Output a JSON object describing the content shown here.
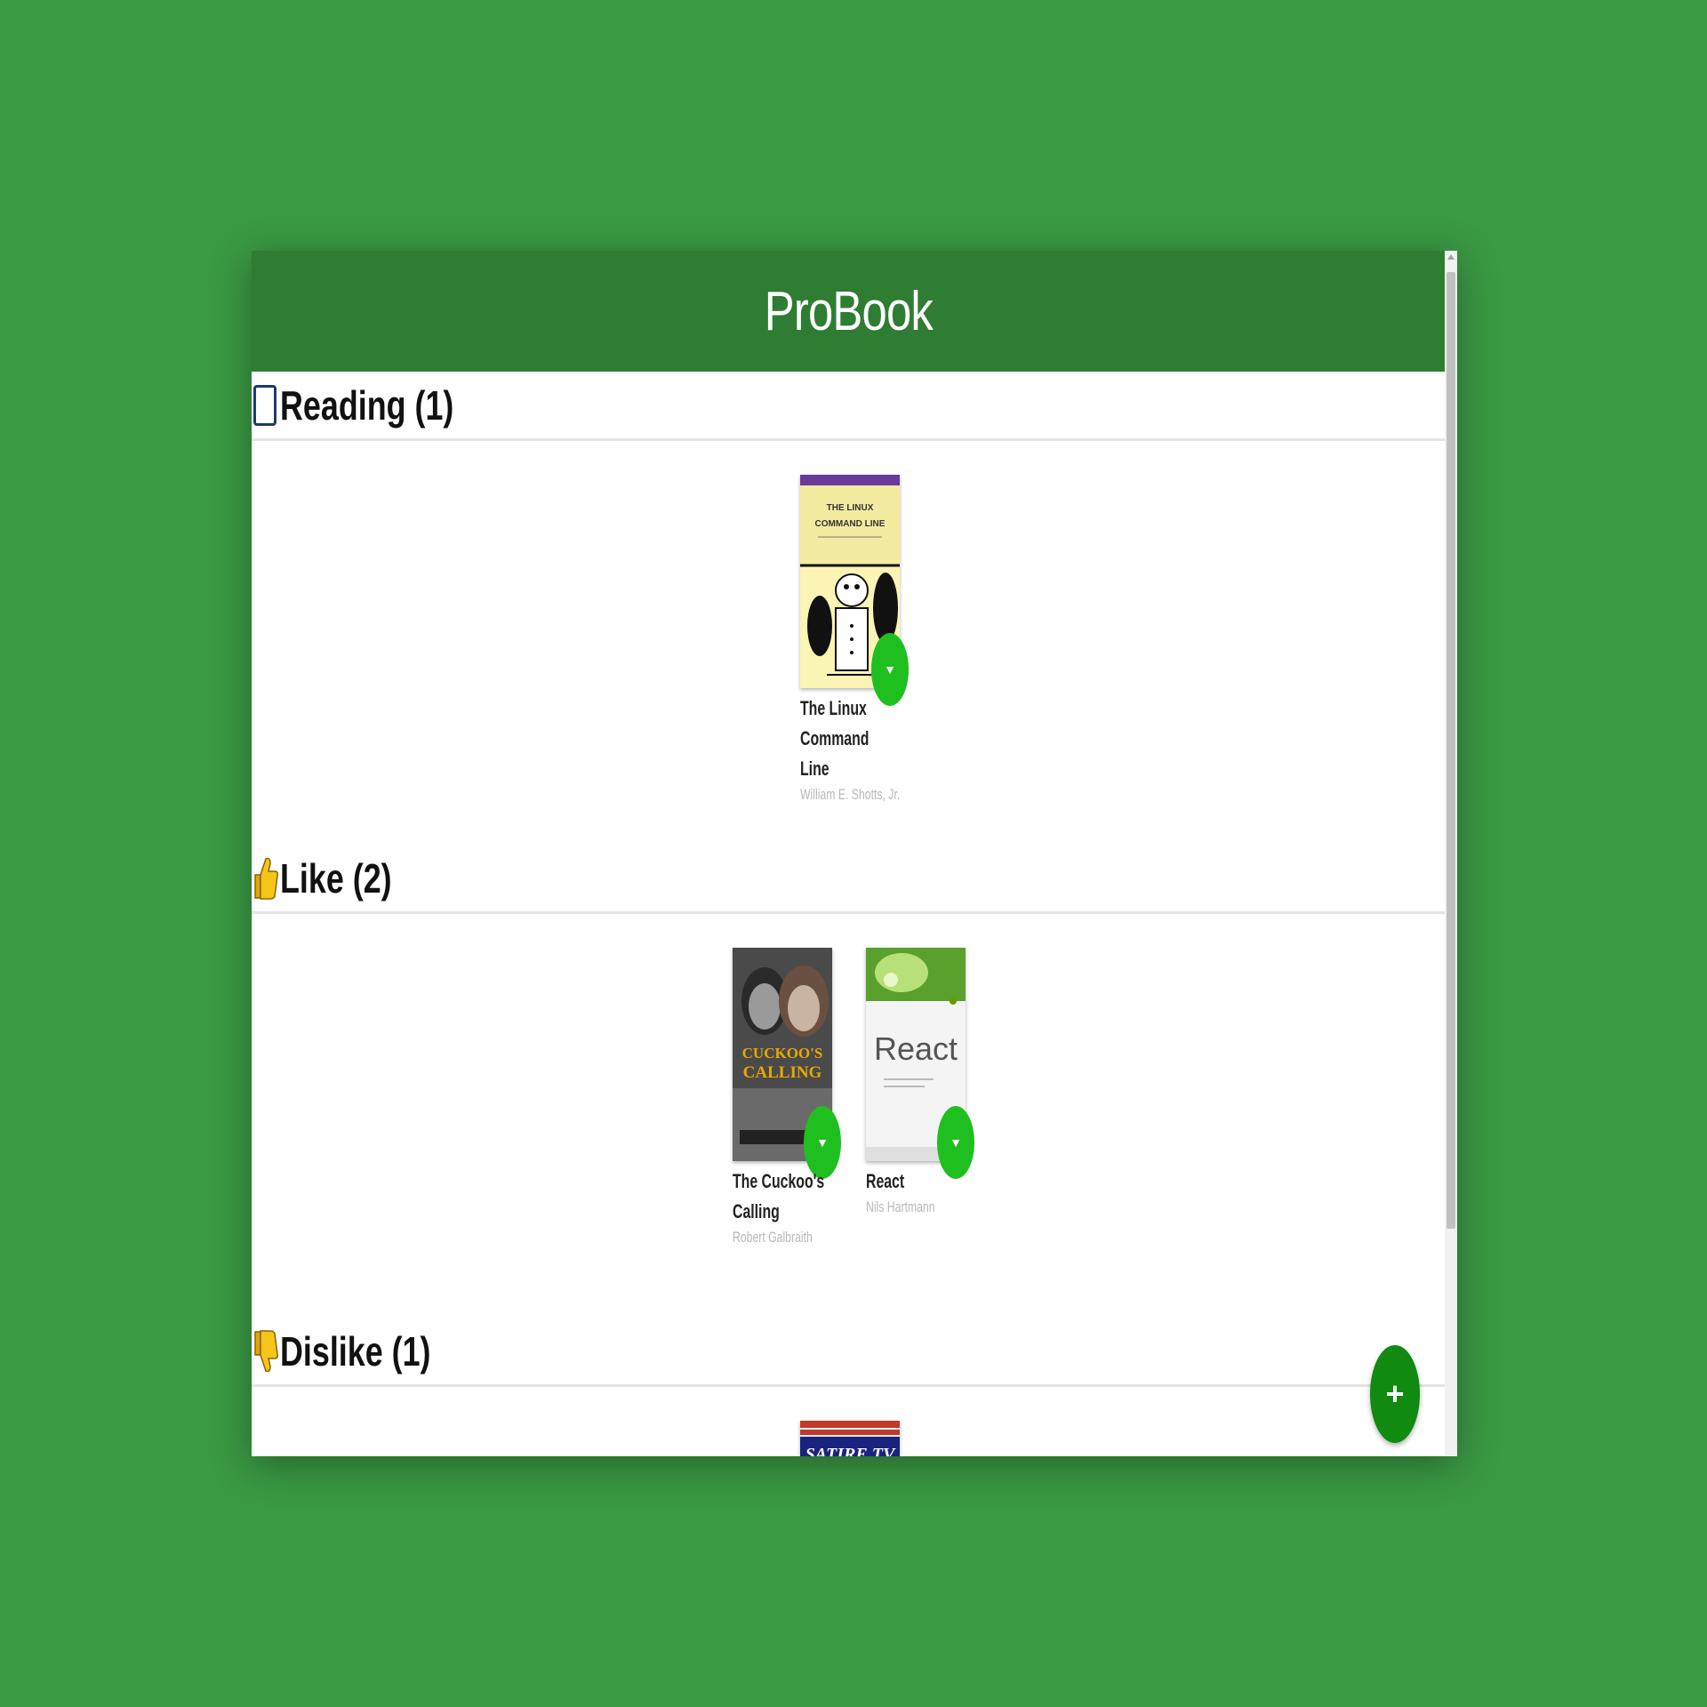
{
  "app": {
    "title": "ProBook"
  },
  "sections": [
    {
      "icon": "tablet-icon",
      "label": "Reading (1)",
      "books": [
        {
          "title": "The Linux Command Line",
          "author": "William E. Shotts, Jr.",
          "cover_text": "THE LINUX COMMAND LINE"
        }
      ]
    },
    {
      "icon": "thumbs-up-icon",
      "label": "Like (2)",
      "books": [
        {
          "title": "The Cuckoo's Calling",
          "author": "Robert Galbraith",
          "cover_text": "THE CUCKOO'S CALLING"
        },
        {
          "title": "React",
          "author": "Nils Hartmann",
          "cover_text": "React"
        }
      ]
    },
    {
      "icon": "thumbs-down-icon",
      "label": "Dislike (1)",
      "books": [
        {
          "title": "",
          "author": "",
          "cover_text": "SATIRE TV"
        }
      ]
    }
  ],
  "book_menu_glyph": "▼",
  "fab_glyph": "+",
  "colors": {
    "page_background": "#3a9943",
    "header": "#2e7d32",
    "book_menu_button": "#1fbf1f",
    "fab": "#108a10"
  }
}
